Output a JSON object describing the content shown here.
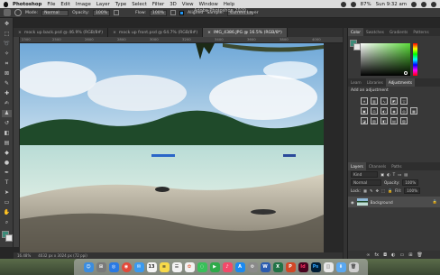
{
  "menubar": {
    "app_name": "Photoshop",
    "items": [
      "File",
      "Edit",
      "Image",
      "Layer",
      "Type",
      "Select",
      "Filter",
      "3D",
      "View",
      "Window",
      "Help"
    ],
    "battery": "87%",
    "time": "Sun 9:32 am"
  },
  "window_title": "Adobe Photoshop 2020",
  "options_bar": {
    "mode_label": "Mode:",
    "mode_value": "Normal",
    "opacity_label": "Opacity:",
    "opacity_value": "100%",
    "flow_label": "Flow:",
    "flow_value": "100%",
    "aligned_label": "Aligned",
    "sample_label": "Sample:",
    "sample_value": "Current Layer"
  },
  "tabs": [
    {
      "label": "mock up back.psd @ 46.9% (RGB/8#)",
      "active": false
    },
    {
      "label": "mock up front.psd @ 64.7% (RGB/8#)",
      "active": false
    },
    {
      "label": "IMG_4386.JPG @ 16.5% (RGB/8*)",
      "active": true
    }
  ],
  "ruler_ticks": [
    "2300",
    "2500",
    "2600",
    "2800",
    "3000",
    "3200",
    "3400",
    "3600",
    "3800",
    "4000"
  ],
  "status": {
    "zoom": "16.48%",
    "doc_size": "4032 px x 3024 px (72 ppi)"
  },
  "color_panel": {
    "tabs": [
      "Color",
      "Swatches",
      "Gradients",
      "Patterns"
    ]
  },
  "adjustments_panel": {
    "tabs": [
      "Learn",
      "Libraries",
      "Adjustments"
    ],
    "heading": "Add an adjustment"
  },
  "layers_panel": {
    "tabs": [
      "Layers",
      "Channels",
      "Paths"
    ],
    "kind_label": "Kind",
    "blend_mode": "Normal",
    "opacity_label": "Opacity:",
    "opacity_value": "100%",
    "lock_label": "Lock:",
    "fill_label": "Fill:",
    "fill_value": "100%",
    "layer_name": "Background"
  },
  "dock": {
    "apps": [
      "finder",
      "launchpad",
      "safari",
      "chrome",
      "mail",
      "calendar",
      "notes",
      "reminders",
      "photos",
      "messages",
      "facetime",
      "music",
      "appstore",
      "settings",
      "word",
      "excel",
      "powerpoint",
      "indesign",
      "photoshop",
      "preview",
      "finder-folder",
      "trash"
    ],
    "calendar_day": "13"
  },
  "colors": {
    "accent": "#2196f3",
    "panel": "#383838",
    "photoshop_blue": "#31a8ff"
  }
}
